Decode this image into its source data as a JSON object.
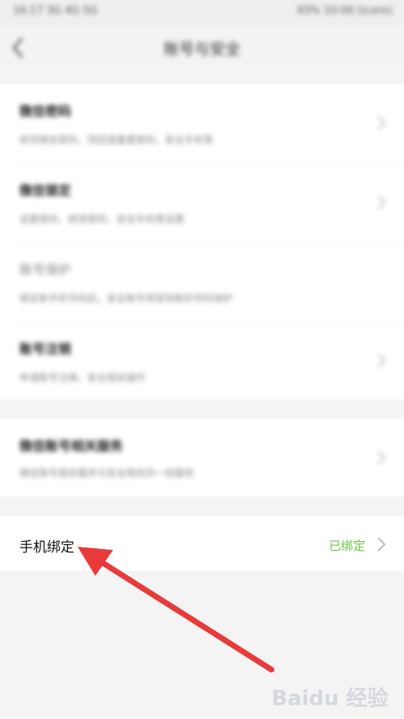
{
  "statusbar": {
    "left": "16:17 3G 4G 5G",
    "right": "93% 10:00 (icons)"
  },
  "navbar": {
    "title": "账号与安全"
  },
  "sections": [
    {
      "items": [
        {
          "title": "微信密码",
          "desc": "修改微信密码，找回或重置密码，安全手机等",
          "light": false
        },
        {
          "title": "微信锁定",
          "desc": "设置密码，修改密码，安全手机等设置",
          "light": false
        },
        {
          "title": "账号保护",
          "desc": "绑定新手机号码后，安全账号将受到新的号码保护",
          "light": true
        },
        {
          "title": "账号注销",
          "desc": "申请账号注销，安全相关操作",
          "light": false
        }
      ]
    },
    {
      "items": [
        {
          "title": "微信账号相关服务",
          "desc": "微信账号相关服务与安全相关的一些服务",
          "light": false
        }
      ]
    }
  ],
  "phone": {
    "label": "手机绑定",
    "status": "已绑定"
  },
  "watermark": {
    "text": "Baidu 经验"
  },
  "colors": {
    "accent_green": "#6cc644",
    "arrow_red": "#e83a3a"
  },
  "icons": {
    "back": "chevron-left-icon",
    "row": "chevron-right-icon"
  }
}
